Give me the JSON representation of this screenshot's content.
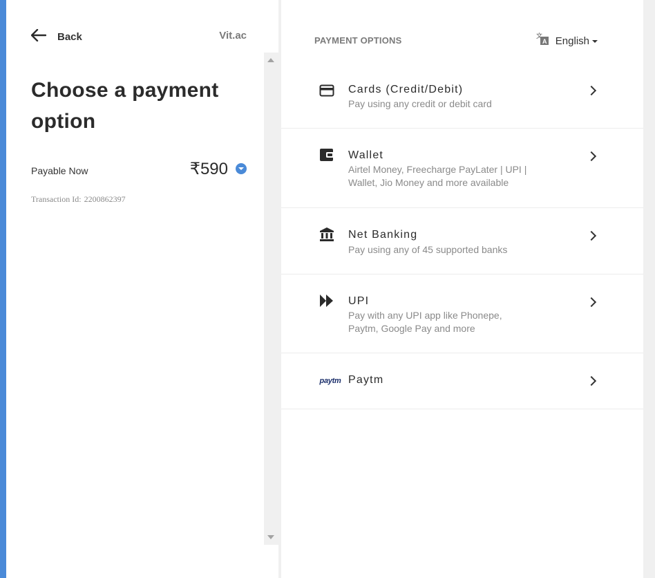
{
  "header": {
    "back_label": "Back",
    "brand": "Vit.ac"
  },
  "summary": {
    "title": "Choose a payment option",
    "payable_label": "Payable Now",
    "amount": "₹590",
    "transaction_label": "Transaction Id:",
    "transaction_id": "2200862397"
  },
  "payment": {
    "section_title": "PAYMENT OPTIONS",
    "language": "English",
    "options": [
      {
        "title": "Cards (Credit/Debit)",
        "desc": "Pay using any credit or debit card",
        "icon": "card-icon"
      },
      {
        "title": "Wallet",
        "desc": "Airtel Money, Freecharge PayLater | UPI | Wallet, Jio Money and more available",
        "icon": "wallet-icon"
      },
      {
        "title": "Net Banking",
        "desc": "Pay using any of 45 supported banks",
        "icon": "bank-icon"
      },
      {
        "title": "UPI",
        "desc": "Pay with any UPI app like Phonepe, Paytm, Google Pay and more",
        "icon": "upi-icon"
      },
      {
        "title": "Paytm",
        "desc": "",
        "icon": "paytm-logo-icon",
        "logo_text": "paytm"
      }
    ]
  },
  "colors": {
    "accent": "#4a8ad8",
    "text": "#2b2b2b",
    "muted": "#8a8a8a"
  }
}
